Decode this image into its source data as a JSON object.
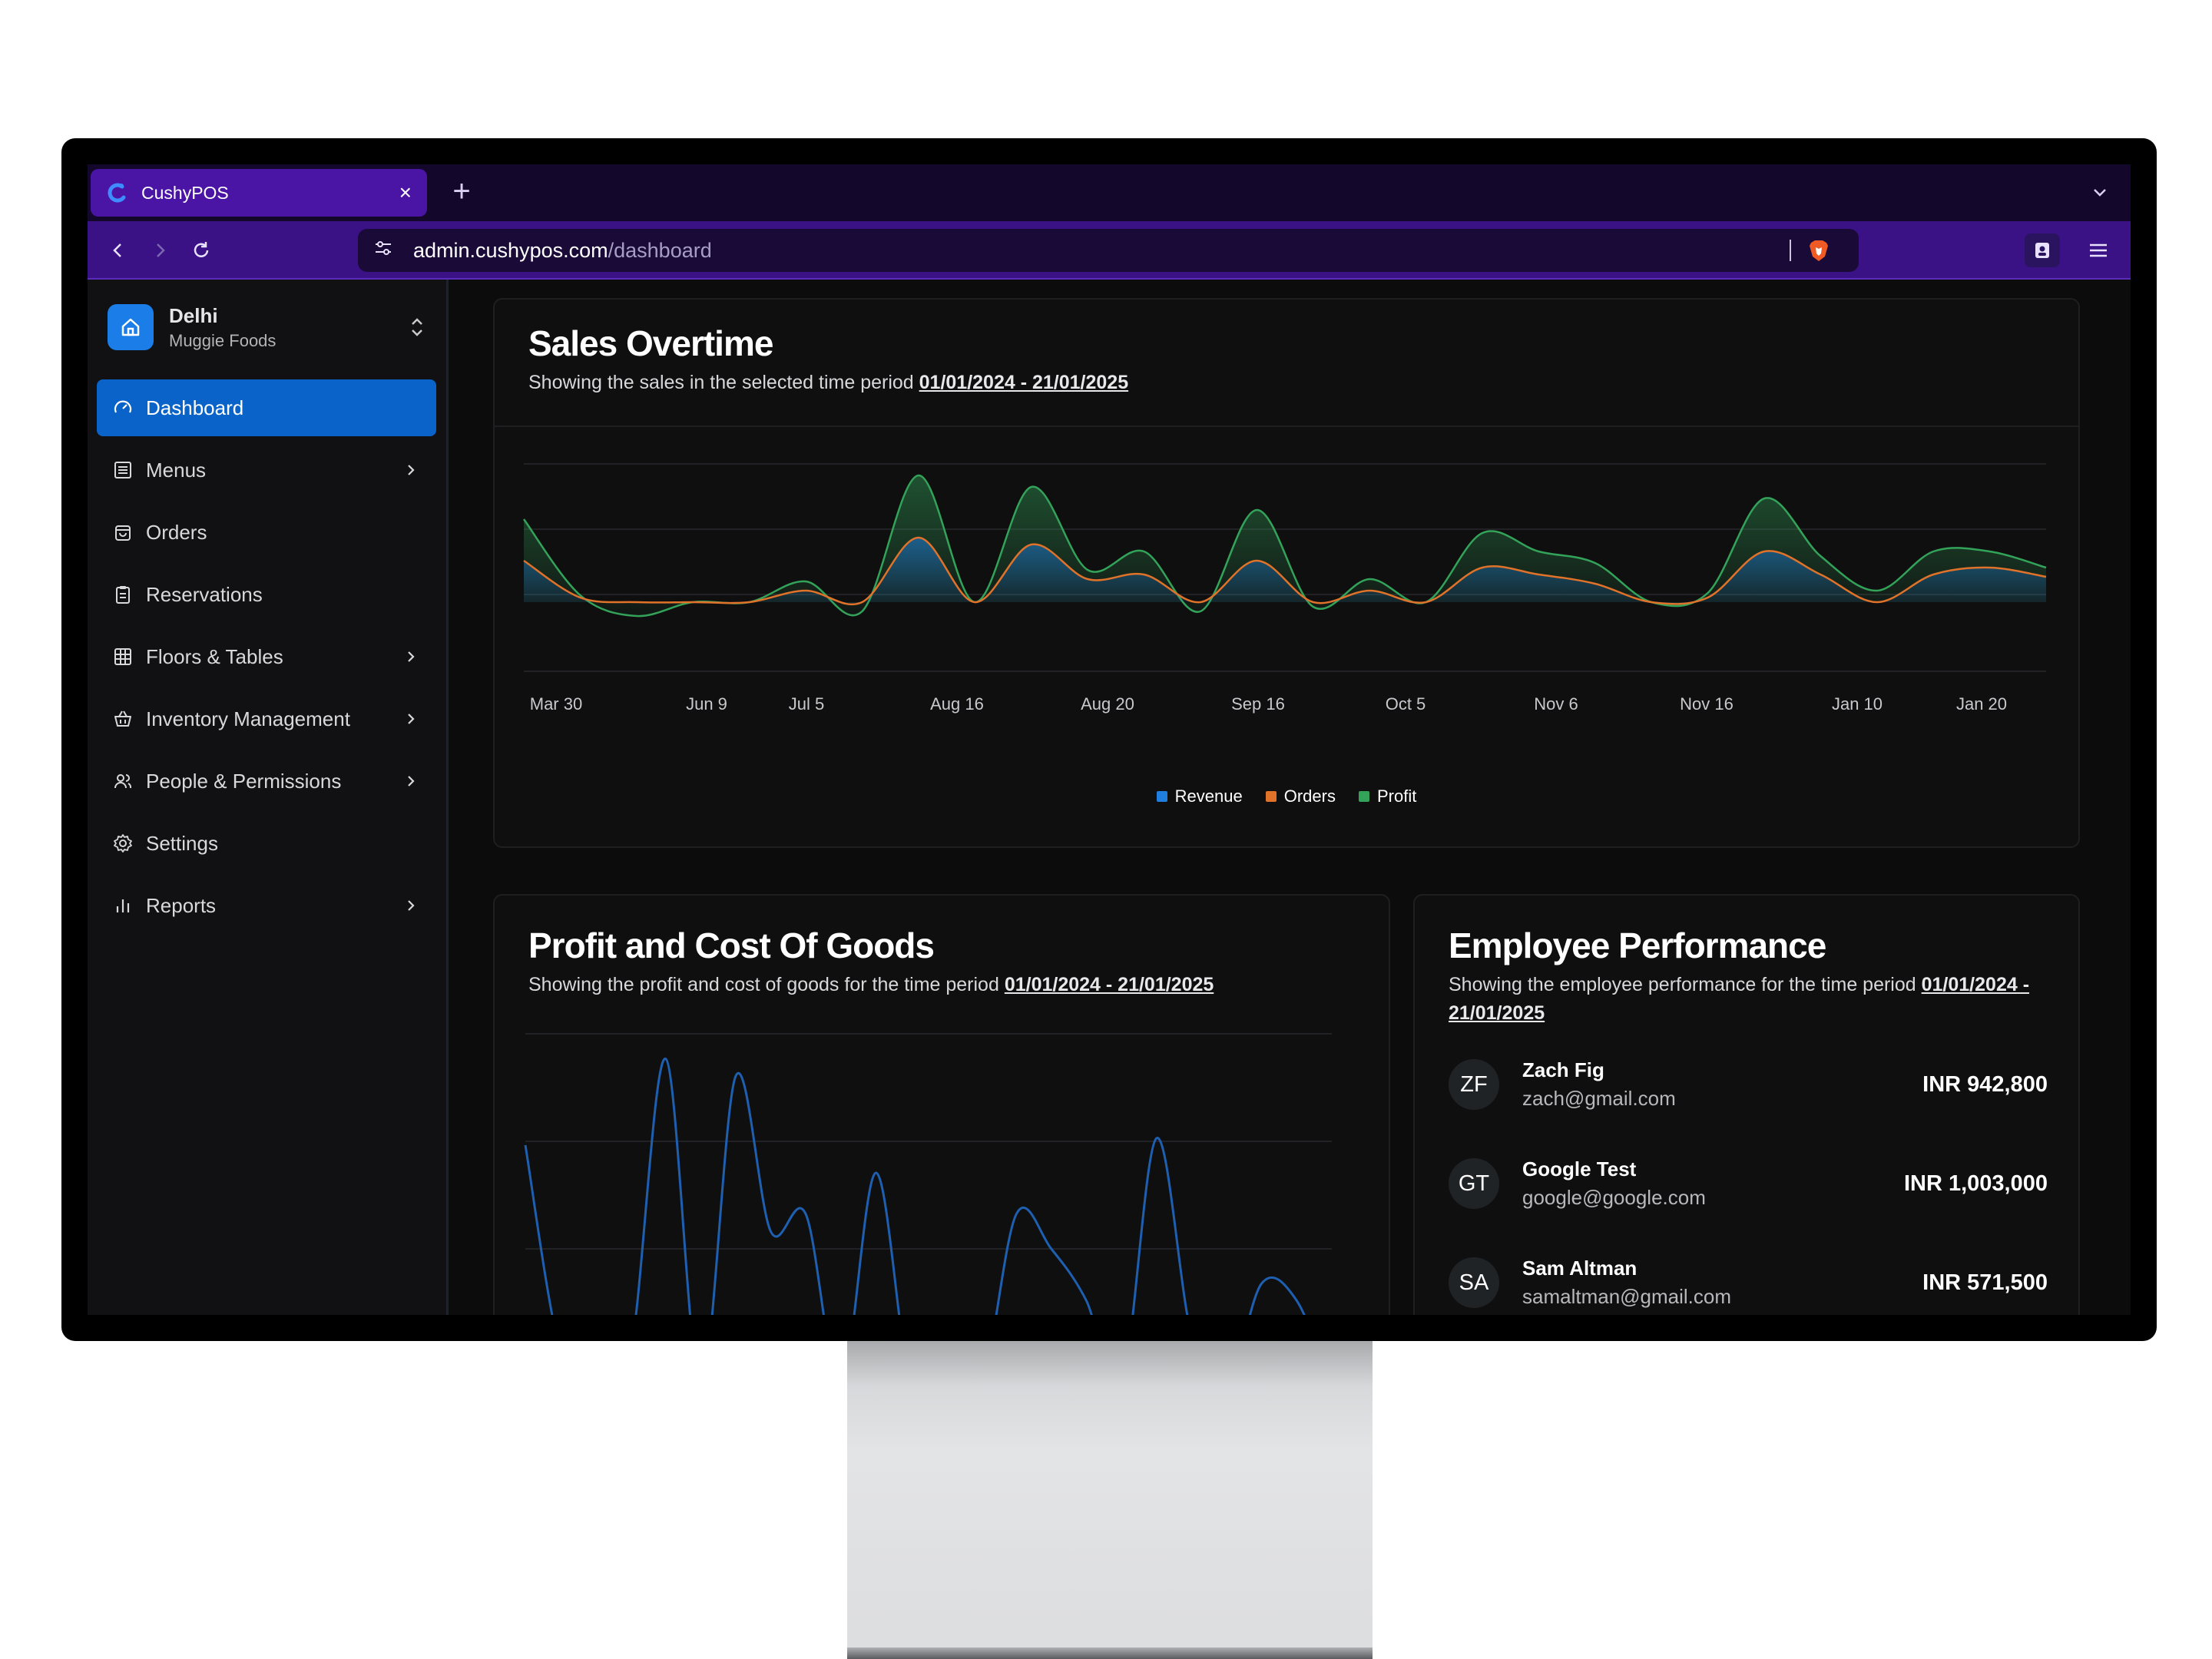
{
  "browser": {
    "tab_title": "CushyPOS",
    "tab_close": "×",
    "new_tab": "+",
    "url_host": "admin.cushypos.com",
    "url_path": "/dashboard"
  },
  "sidebar": {
    "store_name": "Delhi",
    "store_sub": "Muggie Foods",
    "items": [
      {
        "label": "Dashboard",
        "icon": "gauge-icon",
        "active": true,
        "chevron": false
      },
      {
        "label": "Menus",
        "icon": "menu-list-icon",
        "chevron": true
      },
      {
        "label": "Orders",
        "icon": "shopping-bag-icon",
        "chevron": false
      },
      {
        "label": "Reservations",
        "icon": "clipboard-icon",
        "chevron": false
      },
      {
        "label": "Floors & Tables",
        "icon": "grid-icon",
        "chevron": true
      },
      {
        "label": "Inventory Management",
        "icon": "basket-icon",
        "chevron": true
      },
      {
        "label": "People & Permissions",
        "icon": "users-icon",
        "chevron": true
      },
      {
        "label": "Settings",
        "icon": "gear-icon",
        "chevron": false
      },
      {
        "label": "Reports",
        "icon": "bar-chart-icon",
        "chevron": true
      }
    ]
  },
  "sales": {
    "title": "Sales Overtime",
    "subtitle": "Showing the sales in the selected time period",
    "period": "01/01/2024 - 21/01/2025"
  },
  "profit": {
    "title": "Profit and Cost Of Goods",
    "subtitle": "Showing the profit and cost of goods for the time period",
    "period": "01/01/2024 - 21/01/2025"
  },
  "employees": {
    "title": "Employee Performance",
    "subtitle": "Showing the employee performance for the time period",
    "period": "01/01/2024 - 21/01/2025",
    "rows": [
      {
        "initials": "ZF",
        "name": "Zach Fig",
        "email": "zach@gmail.com",
        "amount": "INR 942,800"
      },
      {
        "initials": "GT",
        "name": "Google Test",
        "email": "google@google.com",
        "amount": "INR 1,003,000"
      },
      {
        "initials": "SA",
        "name": "Sam Altman",
        "email": "samaltman@gmail.com",
        "amount": "INR 571,500"
      }
    ]
  },
  "colors": {
    "revenue": "#1f7ee0",
    "orders": "#e0722a",
    "profit": "#33a35a",
    "accent": "#0a63c9"
  },
  "chart_data": [
    {
      "type": "area",
      "x_ticks": [
        "Mar 30",
        "Jun 9",
        "Jul 5",
        "Aug 16",
        "Aug 20",
        "Sep 16",
        "Oct 5",
        "Nov 6",
        "Nov 16",
        "Jan 10",
        "Jan 20"
      ],
      "legend": [
        "Revenue",
        "Orders",
        "Profit"
      ],
      "legend_position": "bottom-center",
      "grid": true,
      "series": [
        {
          "name": "Revenue",
          "values": [
            18,
            2,
            0,
            0,
            0,
            5,
            0,
            28,
            0,
            25,
            10,
            12,
            0,
            18,
            0,
            5,
            0,
            15,
            12,
            8,
            0,
            2,
            22,
            12,
            0,
            12,
            15,
            11
          ]
        },
        {
          "name": "Orders",
          "values": [
            18,
            2,
            0,
            0,
            0,
            5,
            0,
            28,
            0,
            25,
            10,
            12,
            0,
            18,
            0,
            5,
            0,
            15,
            12,
            8,
            0,
            2,
            22,
            12,
            0,
            12,
            15,
            11
          ]
        },
        {
          "name": "Profit",
          "values": [
            36,
            3,
            -6,
            0,
            0,
            9,
            -4,
            55,
            0,
            50,
            14,
            22,
            -4,
            40,
            -2,
            10,
            0,
            30,
            22,
            17,
            0,
            4,
            45,
            20,
            5,
            22,
            22,
            15
          ]
        }
      ]
    },
    {
      "type": "line",
      "series": [
        {
          "values": [
            70,
            10,
            0,
            10,
            95,
            0,
            90,
            45,
            50,
            0,
            62,
            0,
            5,
            0,
            50,
            40,
            25,
            0,
            72,
            15,
            0,
            30,
            25,
            0
          ]
        }
      ],
      "grid": true
    }
  ]
}
